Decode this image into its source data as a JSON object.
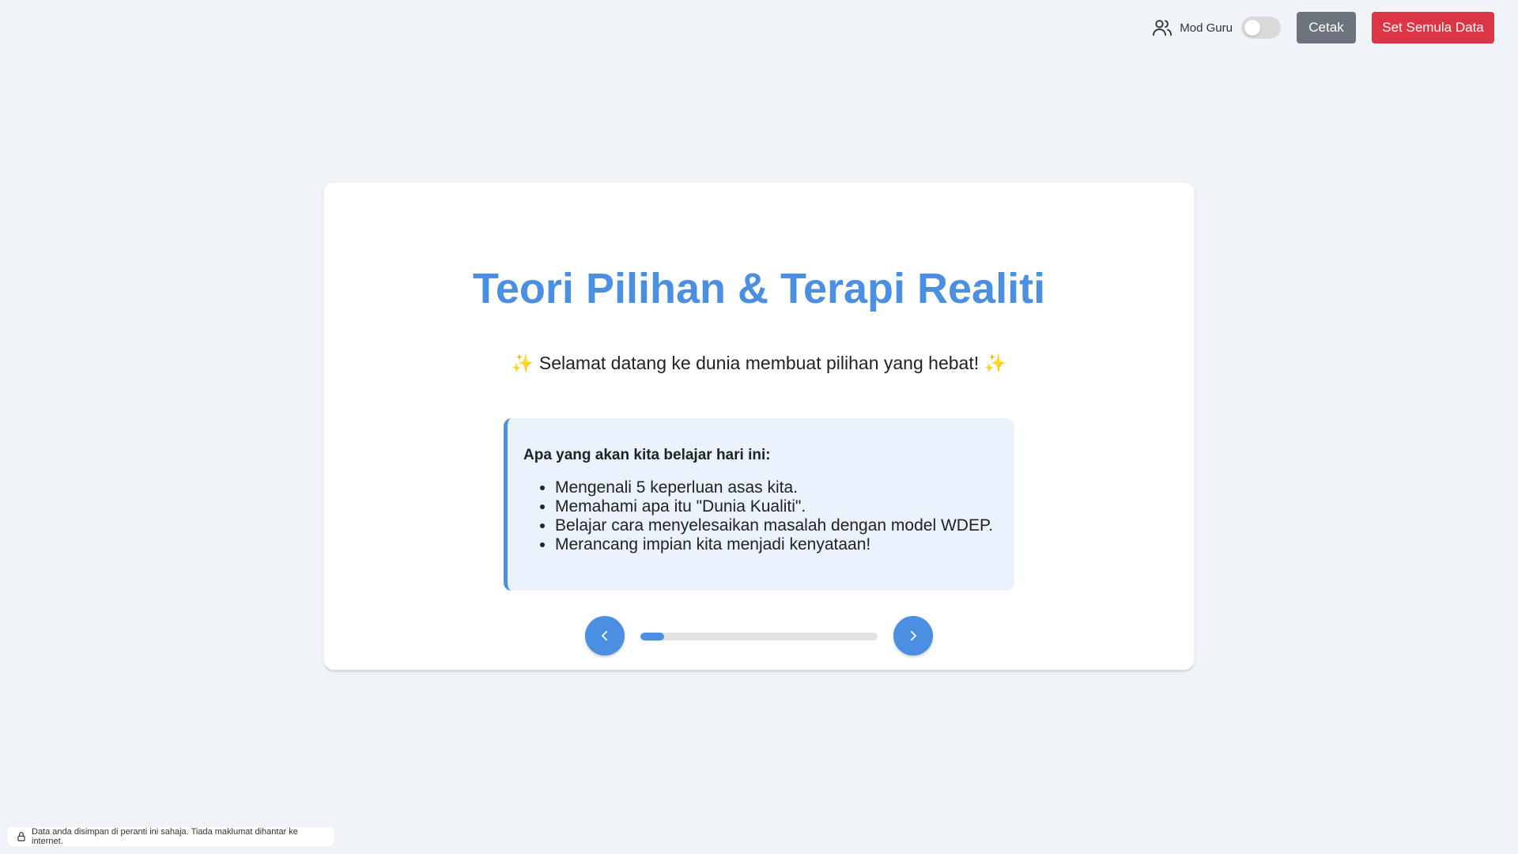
{
  "header": {
    "teacher_mode_label": "Mod Guru",
    "teacher_mode_on": false,
    "print_label": "Cetak",
    "reset_label": "Set Semula Data",
    "icon": "users-icon"
  },
  "slide": {
    "title": "Teori Pilihan & Terapi Realiti",
    "subtitle": "✨ Selamat datang ke dunia membuat pilihan yang hebat! ✨",
    "info_heading": "Apa yang akan kita belajar hari ini:",
    "info_items": [
      "Mengenali 5 keperluan asas kita.",
      "Memahami apa itu \"Dunia Kualiti\".",
      "Belajar cara menyelesaikan masalah dengan model WDEP.",
      "Merancang impian kita menjadi kenyataan!"
    ]
  },
  "navigation": {
    "prev_icon": "chevron-left-icon",
    "next_icon": "chevron-right-icon",
    "progress_fraction": 0.1
  },
  "footer": {
    "privacy_text": "Data anda disimpan di peranti ini sahaja. Tiada maklumat dihantar ke internet.",
    "icon": "lock-icon"
  },
  "colors": {
    "accent": "#4a8fe2",
    "danger": "#dc3545",
    "secondary": "#6b747d",
    "background": "#f0f3f8"
  }
}
